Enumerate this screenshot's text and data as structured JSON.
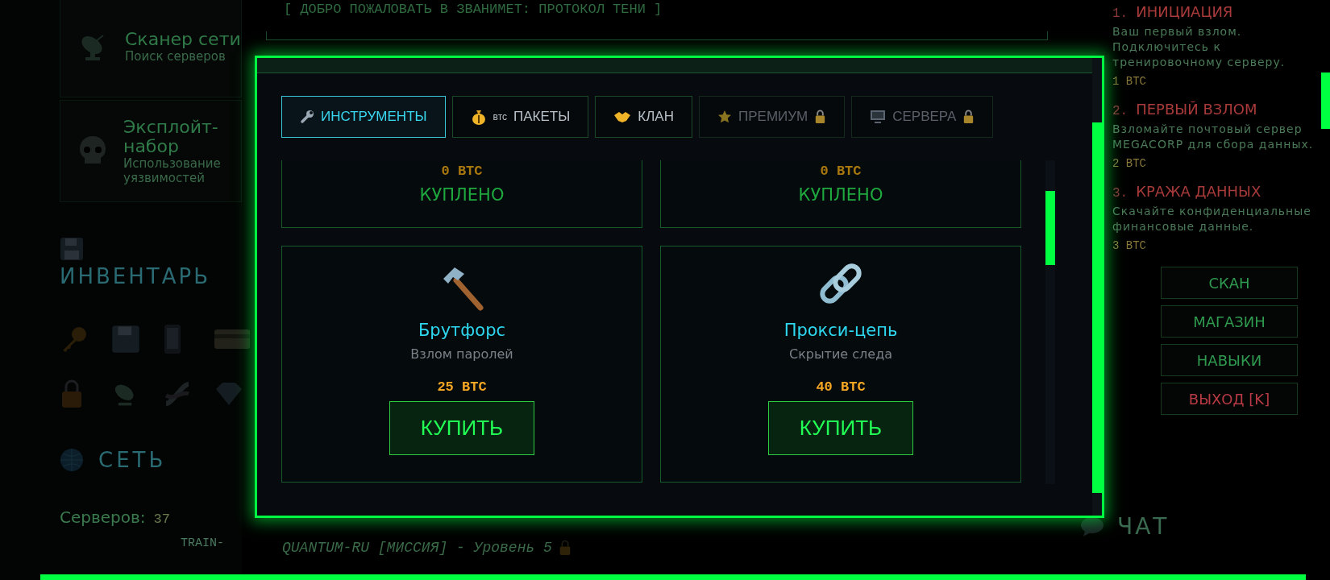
{
  "sidebar": {
    "tools": [
      {
        "title": "Сканер сети",
        "subtitle": "Поиск серверов"
      },
      {
        "title": "Эксплойт-набор",
        "subtitle": "Использование уязвимостей"
      }
    ],
    "inventory": {
      "title": "ИНВЕНТАРЬ"
    },
    "network": {
      "title": "СЕТЬ",
      "servers_label": "Серверов:",
      "servers_count": "37",
      "server_name": "TRAIN-"
    }
  },
  "main": {
    "banner": "[ ДОБРО ПОЖАЛОВАТЬ В ЗВАНИМЕТ: ПРОТОКОЛ ТЕНИ ]",
    "mission_line": "QUANTUM-RU [МИССИЯ] - Уровень 5"
  },
  "missions": [
    {
      "number": "1.",
      "title": "ИНИЦИАЦИЯ",
      "description": "Ваш первый взлом. Подключитесь к тренировочному серверу.",
      "reward": "1 BTC"
    },
    {
      "number": "2.",
      "title": "ПЕРВЫЙ ВЗЛОМ",
      "description": "Взломайте почтовый сервер MEGACORP для сбора данных.",
      "reward": "2 BTC"
    },
    {
      "number": "3.",
      "title": "КРАЖА ДАННЫХ",
      "description": "Скачайте конфиденциальные финансовые данные.",
      "reward": "3 BTC"
    }
  ],
  "menu": [
    {
      "label": "СКАН",
      "kind": "normal"
    },
    {
      "label": "МАГАЗИН",
      "kind": "normal"
    },
    {
      "label": "НАВЫКИ",
      "kind": "normal"
    },
    {
      "label": "ВЫХОД [K]",
      "kind": "danger"
    }
  ],
  "chat": {
    "title": "ЧАТ"
  },
  "shop": {
    "tabs": [
      {
        "label": "ИНСТРУМЕНТЫ",
        "selected": true,
        "locked": false
      },
      {
        "label": "ПАКЕТЫ",
        "prefix": "втс",
        "selected": false,
        "locked": false
      },
      {
        "label": "КЛАН",
        "selected": false,
        "locked": false
      },
      {
        "label": "ПРЕМИУМ",
        "selected": false,
        "locked": true
      },
      {
        "label": "СЕРВЕРА",
        "selected": false,
        "locked": true
      }
    ],
    "items": [
      {
        "price": "0 BTC",
        "purchased": true,
        "status": "КУПЛЕНО"
      },
      {
        "price": "0 BTC",
        "purchased": true,
        "status": "КУПЛЕНО"
      },
      {
        "name": "Брутфорс",
        "description": "Взлом паролей",
        "price": "25 BTC",
        "purchased": false,
        "button": "КУПИТЬ"
      },
      {
        "name": "Прокси-цепь",
        "description": "Скрытие следа",
        "price": "40 BTC",
        "purchased": false,
        "button": "КУПИТЬ"
      }
    ]
  }
}
